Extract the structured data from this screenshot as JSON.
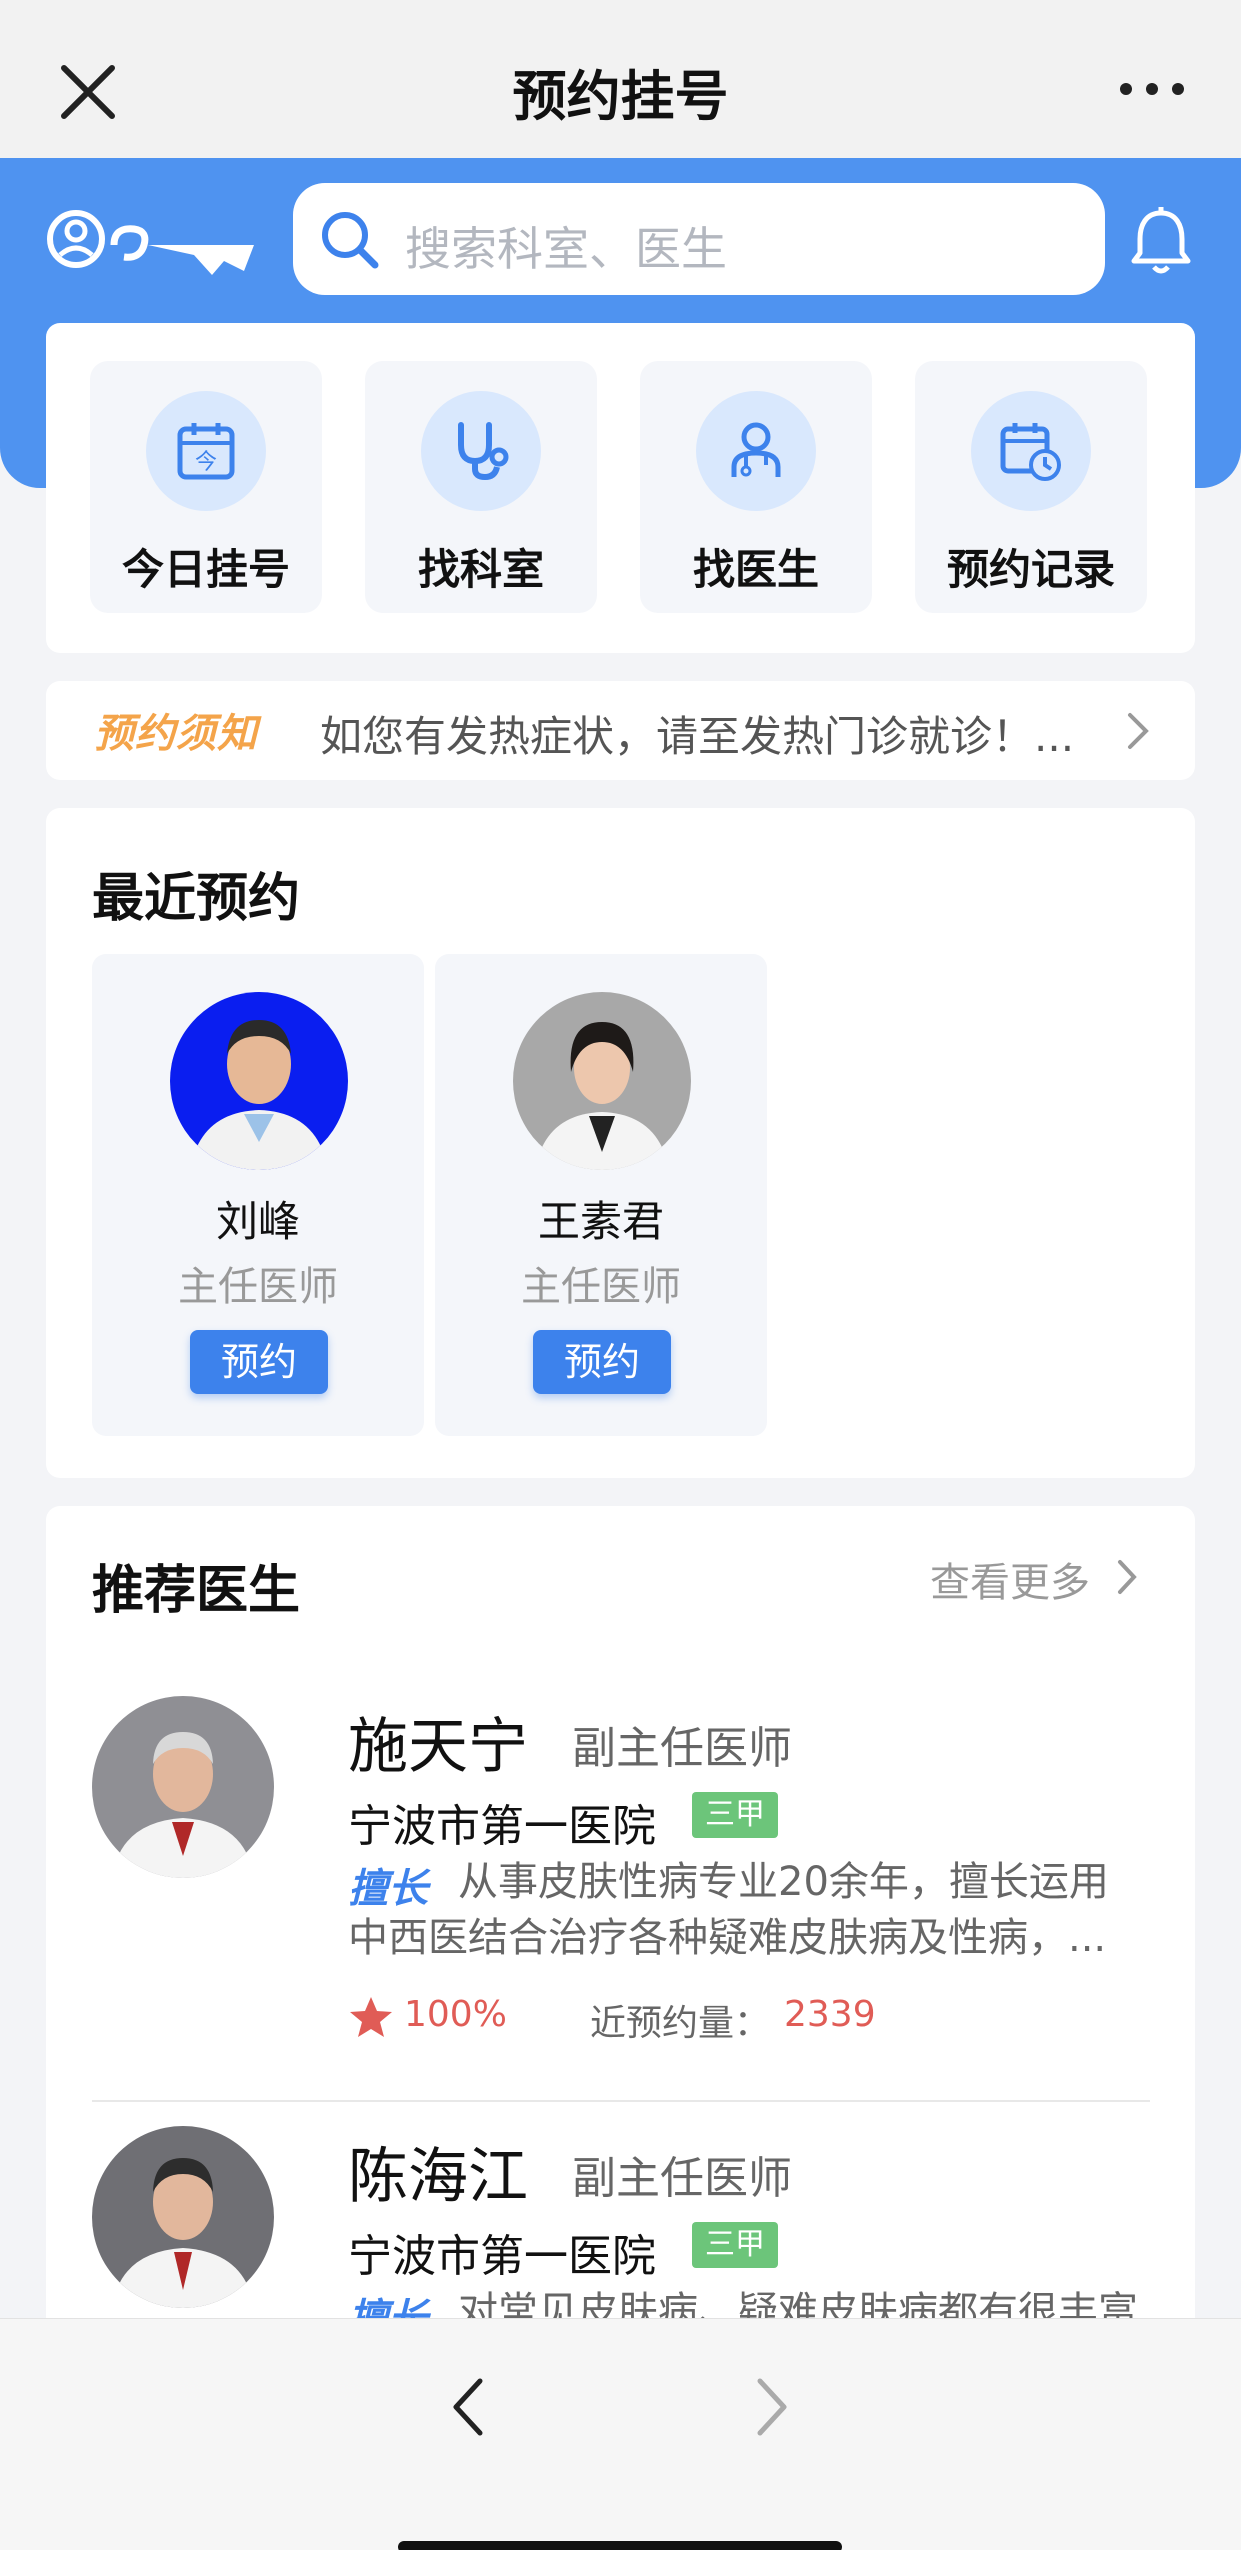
{
  "nav": {
    "title": "预约挂号"
  },
  "search": {
    "placeholder": "搜索科室、医生"
  },
  "quick_actions": [
    {
      "label": "今日挂号",
      "icon": "calendar-today-icon",
      "glyph": "今"
    },
    {
      "label": "找科室",
      "icon": "stethoscope-icon"
    },
    {
      "label": "找医生",
      "icon": "doctor-icon"
    },
    {
      "label": "预约记录",
      "icon": "calendar-clock-icon"
    }
  ],
  "notice": {
    "tag": "预约须知",
    "text": "如您有发热症状，请至发热门诊就诊！..."
  },
  "recent": {
    "title": "最近预约",
    "doctors": [
      {
        "name": "刘峰",
        "title": "主任医师",
        "button": "预约",
        "photo_bg": "#0a1ef0"
      },
      {
        "name": "王素君",
        "title": "主任医师",
        "button": "预约",
        "photo_bg": "#a8a8a8"
      }
    ]
  },
  "recommend": {
    "title": "推荐医生",
    "more": "查看更多",
    "doctors": [
      {
        "name": "施天宁",
        "rank": "副主任医师",
        "hospital": "宁波市第一医院",
        "badge": "三甲",
        "skill_tag": "擅长",
        "skill": "从事皮肤性病专业20余年，擅长运用中西医结合治疗各种疑难皮肤病及性病，...",
        "rating": "100%",
        "count_label": "近预约量：",
        "count": "2339"
      },
      {
        "name": "陈海江",
        "rank": "副主任医师",
        "hospital": "宁波市第一医院",
        "badge": "三甲",
        "skill_tag": "擅长",
        "skill": "对常见皮肤病、疑难皮肤病都有很丰富的诊治经验"
      }
    ]
  },
  "colors": {
    "primary": "#4f93f0",
    "button": "#3d82ec",
    "badge": "#6cc57a",
    "accent_red": "#e05c56",
    "notice_tag": "#f4a44a"
  }
}
